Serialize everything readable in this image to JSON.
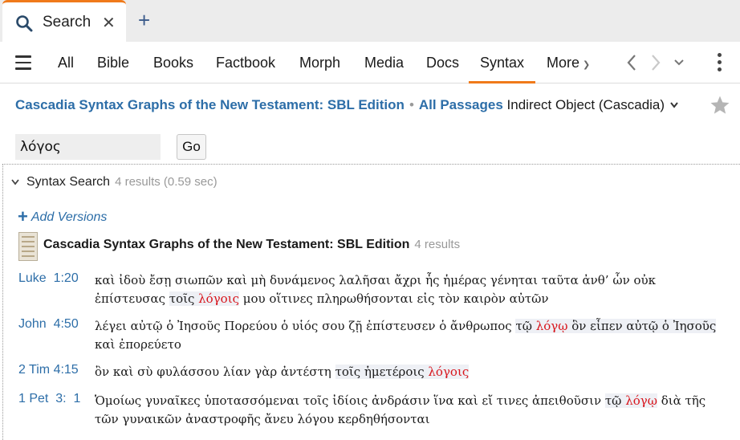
{
  "tabs": [
    {
      "label": "Search",
      "close": "✕",
      "icon": "search-icon"
    }
  ],
  "new_tab_label": "+",
  "nav": {
    "items": [
      "All",
      "Bible",
      "Books",
      "Factbook",
      "Morph",
      "Media",
      "Docs",
      "Syntax"
    ],
    "active": "Syntax",
    "more_label": "More"
  },
  "breadcrumb": {
    "resource": "Cascadia Syntax Graphs of the New Testament: SBL Edition",
    "separator": "•",
    "range": "All Passages",
    "query": "Indirect Object (Cascadia)"
  },
  "search": {
    "value": "λόγος",
    "go_label": "Go"
  },
  "section": {
    "title": "Syntax Search",
    "meta": "4 results (0.59 sec)",
    "add_versions": "Add Versions"
  },
  "book": {
    "title": "Cascadia Syntax Graphs of the New Testament: SBL Edition",
    "meta": "4 results"
  },
  "results": [
    {
      "ref": "Luke  1:20",
      "before": "καὶ ἰδοὺ ἔσῃ σιωπῶν καὶ μὴ δυνάμενος λαλῆσαι ἄχρι ἧς ἡμέρας γένηται ταῦτα ἀνθ’ ὧν οὐκ ἐπίστευσας ",
      "hl_pre": "τοῖς ",
      "hit": "λόγοις",
      "hl_post": "",
      "after": " μου οἵτινες πληρωθήσονται εἰς τὸν καιρὸν αὐτῶν"
    },
    {
      "ref": "John  4:50",
      "before": "λέγει αὐτῷ ὁ Ἰησοῦς Πορεύου ὁ υἱός σου ζῇ ἐπίστευσεν ὁ ἄνθρωπος ",
      "hl_pre": "τῷ ",
      "hit": "λόγῳ",
      "hl_post": " ὃν εἶπεν αὐτῷ ὁ Ἰησοῦς",
      "after": " καὶ ἐπορεύετο"
    },
    {
      "ref": "2 Tim 4:15",
      "before": "ὃν καὶ σὺ φυλάσσου λίαν γὰρ ἀντέστη ",
      "hl_pre": "τοῖς ἡμετέροις ",
      "hit": "λόγοις",
      "hl_post": "",
      "after": ""
    },
    {
      "ref": "1 Pet  3:  1",
      "before": "Ὁμοίως γυναῖκες ὑποτασσόμεναι τοῖς ἰδίοις ἀνδράσιν ἵνα καὶ εἴ τινες ἀπειθοῦσιν ",
      "hl_pre": "τῷ ",
      "hit": "λόγῳ",
      "hl_post": "",
      "after": " διὰ τῆς τῶν γυναικῶν ἀναστροφῆς ἄνευ λόγου κερδηθήσονται"
    }
  ],
  "colors": {
    "accent": "#f07a1a",
    "link": "#2d6ea8",
    "hit": "#d8141b",
    "highlight": "#eef0f5"
  }
}
